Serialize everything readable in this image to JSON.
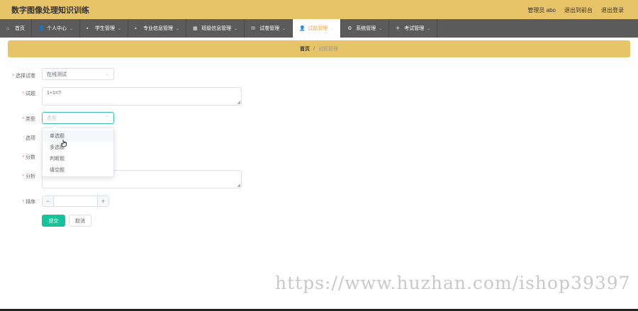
{
  "app": {
    "title": "数字图像处理知识训练",
    "admin_label": "管理员 abo",
    "back_to_front": "退出到前台",
    "logout": "退出登录"
  },
  "nav": [
    {
      "label": "首页",
      "icon": "home-icon",
      "glyph": "⌂",
      "chevron": false,
      "active": false
    },
    {
      "label": "个人中心",
      "icon": "user-icon",
      "glyph": "👤",
      "chevron": true,
      "active": false
    },
    {
      "label": "学生管理",
      "icon": "chat-icon",
      "glyph": "▪",
      "chevron": true,
      "active": false
    },
    {
      "label": "专业信息管理",
      "icon": "chat-icon",
      "glyph": "▪",
      "chevron": true,
      "active": false
    },
    {
      "label": "班级信息管理",
      "icon": "grid-icon",
      "glyph": "▦",
      "chevron": true,
      "active": false
    },
    {
      "label": "试卷管理",
      "icon": "mail-icon",
      "glyph": "✉",
      "chevron": true,
      "active": false
    },
    {
      "label": "试题管理",
      "icon": "user-icon",
      "glyph": "👤",
      "chevron": true,
      "active": true
    },
    {
      "label": "系统管理",
      "icon": "gear-icon",
      "glyph": "⚙",
      "chevron": true,
      "active": false
    },
    {
      "label": "考试管理",
      "icon": "pin-icon",
      "glyph": "✈",
      "chevron": true,
      "active": false
    }
  ],
  "breadcrumb": {
    "home": "首页",
    "separator": "/",
    "current": "试题管理"
  },
  "form": {
    "paper_label": "选择试卷",
    "paper_value": "在线测试",
    "question_label": "试题",
    "question_value": "1+1=?",
    "type_label": "类型",
    "type_placeholder": "类型",
    "options_label": "选项",
    "score_label": "分数",
    "analysis_label": "分析",
    "order_label": "排序",
    "stepper_minus": "−",
    "stepper_plus": "+",
    "submit": "提交",
    "cancel": "取消"
  },
  "type_dropdown": {
    "options": [
      "单选题",
      "多选题",
      "判断题",
      "填空题"
    ],
    "hovered_index": 0
  },
  "watermark": "https://www.huzhan.com/ishop39397",
  "colors": {
    "accent_yellow": "#e8c468",
    "nav_gray": "#5b5b5b",
    "primary_green": "#13c49a",
    "required_red": "#f56c6c"
  }
}
